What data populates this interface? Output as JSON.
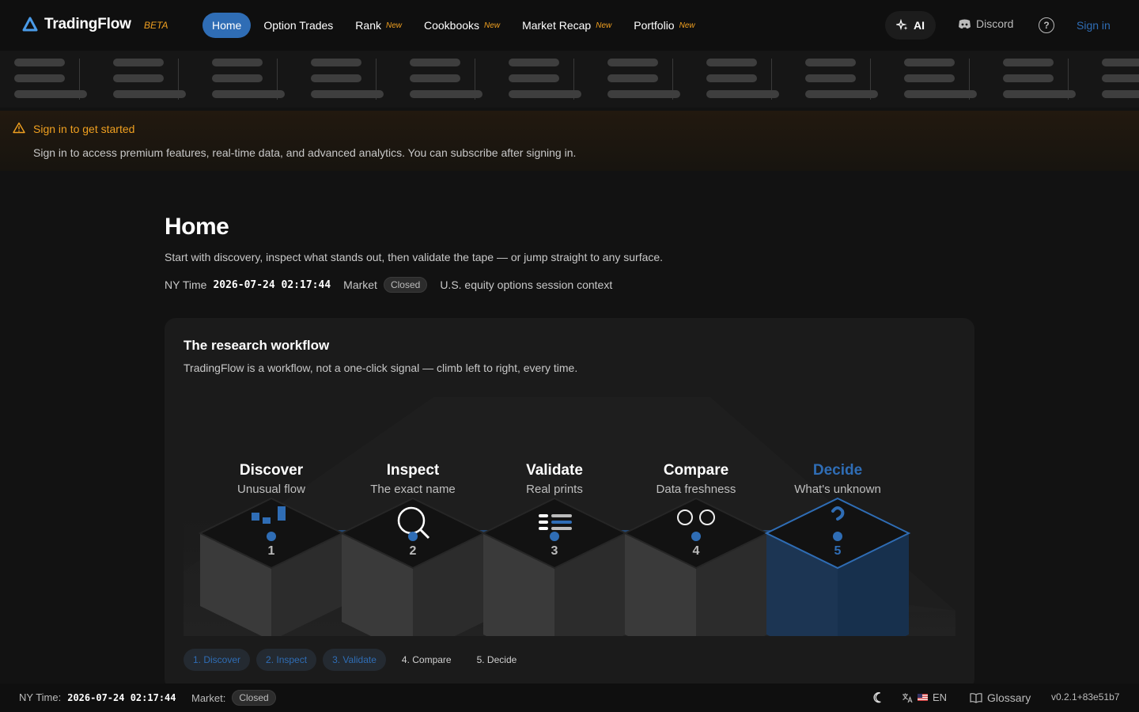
{
  "brand": {
    "name": "TradingFlow",
    "badge": "BETA"
  },
  "nav": {
    "items": [
      {
        "label": "Home",
        "new": "",
        "active": true
      },
      {
        "label": "Option Trades",
        "new": ""
      },
      {
        "label": "Rank",
        "new": "New"
      },
      {
        "label": "Cookbooks",
        "new": "New"
      },
      {
        "label": "Market Recap",
        "new": "New"
      },
      {
        "label": "Portfolio",
        "new": "New"
      }
    ],
    "ai_label": "AI",
    "discord_label": "Discord",
    "help_glyph": "?",
    "signin_label": "Sign in"
  },
  "alert": {
    "title": "Sign in to get started",
    "body": "Sign in to access premium features, real-time data, and advanced analytics. You can subscribe after signing in."
  },
  "home": {
    "title": "Home",
    "subtitle": "Start with discovery, inspect what stands out, then validate the tape — or jump straight to any surface.",
    "ny_time_label": "NY Time",
    "ny_time_value": "2026-07-24 02:17:44",
    "market_label": "Market",
    "market_status": "Closed",
    "context": "U.S. equity options session context"
  },
  "workflow": {
    "title": "The research workflow",
    "subtitle": "TradingFlow is a workflow, not a one-click signal — climb left to right, every time.",
    "steps": [
      {
        "num": "1",
        "name": "Discover",
        "desc": "Unusual flow",
        "icon": "bar-chart-icon"
      },
      {
        "num": "2",
        "name": "Inspect",
        "desc": "The exact name",
        "icon": "magnifier-icon"
      },
      {
        "num": "3",
        "name": "Validate",
        "desc": "Real prints",
        "icon": "list-icon"
      },
      {
        "num": "4",
        "name": "Compare",
        "desc": "Data freshness",
        "icon": "binoculars-icon"
      },
      {
        "num": "5",
        "name": "Decide",
        "desc": "What's unknown",
        "icon": "question-icon"
      }
    ],
    "chips": [
      "1. Discover",
      "2. Inspect",
      "3. Validate",
      "4. Compare",
      "5. Decide"
    ],
    "chips_done": 3,
    "highlight_step": 5,
    "colors": {
      "accent": "#2f6db5",
      "warning": "#f0a020"
    }
  },
  "footer": {
    "ny_time_label": "NY Time:",
    "ny_time_value": "2026-07-24 02:17:44",
    "market_label": "Market:",
    "market_status": "Closed",
    "language": "EN",
    "glossary_label": "Glossary",
    "version": "v0.2.1+83e51b7"
  }
}
